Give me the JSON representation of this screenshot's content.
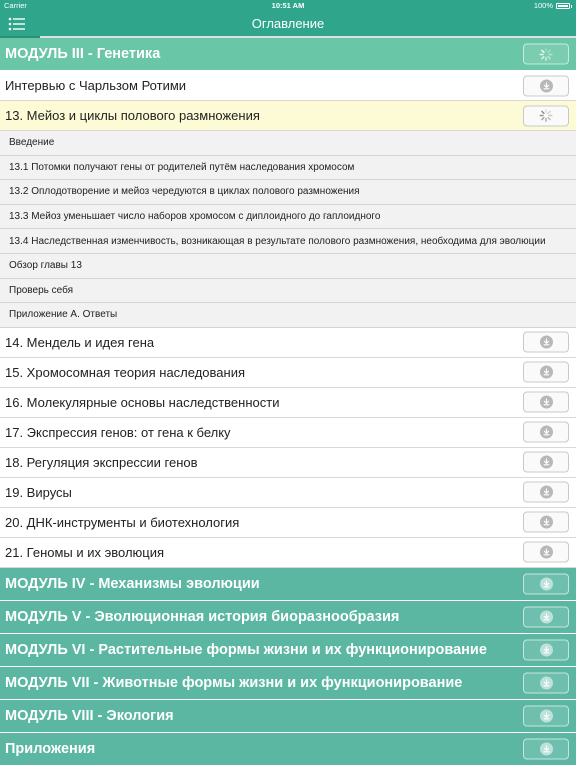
{
  "status_bar": {
    "carrier": "Carrier",
    "time": "10:51 AM",
    "battery": "100%"
  },
  "nav": {
    "title": "Оглавление",
    "menu_icon": "list-menu-icon",
    "progress_fraction": 0.07
  },
  "rows": [
    {
      "kind": "module",
      "label": "МОДУЛЬ III - Генетика",
      "action": "spinner"
    },
    {
      "kind": "chapter",
      "label": "Интервью с Чарльзом Ротими",
      "action": "download"
    },
    {
      "kind": "chapter",
      "label": "13. Мейоз и циклы полового размножения",
      "action": "spinner",
      "active": true
    },
    {
      "kind": "sub",
      "label": "Введение"
    },
    {
      "kind": "sub",
      "label": "13.1 Потомки получают гены от родителей путём наследования хромосом"
    },
    {
      "kind": "sub",
      "label": "13.2 Оплодотворение и мейоз чередуются в циклах полового размножения"
    },
    {
      "kind": "sub",
      "label": "13.3 Мейоз уменьшает число наборов хромосом с диплоидного до гаплоидного"
    },
    {
      "kind": "sub",
      "label": "13.4 Наследственная изменчивость, возникающая в результате полового размножения, необходима для эволюции"
    },
    {
      "kind": "sub",
      "label": "Обзор главы 13"
    },
    {
      "kind": "sub",
      "label": "Проверь себя"
    },
    {
      "kind": "sub",
      "label": "Приложение А. Ответы"
    },
    {
      "kind": "chapter",
      "label": "14. Мендель и идея гена",
      "action": "download"
    },
    {
      "kind": "chapter",
      "label": "15. Хромосомная теория наследования",
      "action": "download"
    },
    {
      "kind": "chapter",
      "label": "16. Молекулярные основы наследственности",
      "action": "download"
    },
    {
      "kind": "chapter",
      "label": "17. Экспрессия генов: от гена к белку",
      "action": "download"
    },
    {
      "kind": "chapter",
      "label": "18. Регуляция экспрессии генов",
      "action": "download"
    },
    {
      "kind": "chapter",
      "label": "19. Вирусы",
      "action": "download"
    },
    {
      "kind": "chapter",
      "label": "20. ДНК-инструменты и биотехнология",
      "action": "download"
    },
    {
      "kind": "chapter",
      "label": "21. Геномы и их эволюция",
      "action": "download"
    },
    {
      "kind": "module",
      "label": "МОДУЛЬ IV - Механизмы эволюции",
      "action": "download",
      "dark": true
    },
    {
      "kind": "module",
      "label": "МОДУЛЬ V - Эволюционная история биоразнообразия",
      "action": "download",
      "dark": true
    },
    {
      "kind": "module",
      "label": "МОДУЛЬ VI - Растительные формы жизни и их функционирование",
      "action": "download",
      "dark": true
    },
    {
      "kind": "module",
      "label": "МОДУЛЬ VII - Животные формы жизни и их функционирование",
      "action": "download",
      "dark": true
    },
    {
      "kind": "module",
      "label": "МОДУЛЬ VIII - Экология",
      "action": "download",
      "dark": true
    },
    {
      "kind": "module",
      "label": "Приложения",
      "action": "download",
      "dark": true
    }
  ],
  "colors": {
    "accent": "#2fa68c",
    "module_bg": "#5bb7a2",
    "active_row": "#fdfbd6",
    "sub_row": "#f2f2f2"
  }
}
